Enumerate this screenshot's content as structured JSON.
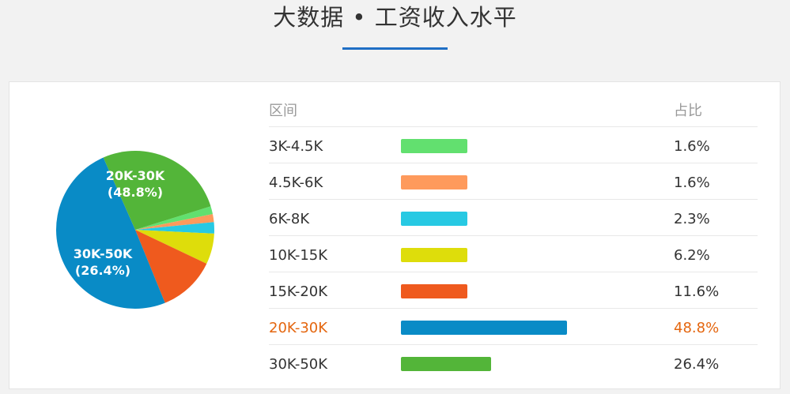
{
  "header": {
    "title": "大数据 • 工资收入水平"
  },
  "table": {
    "col_range": "区间",
    "col_share": "占比"
  },
  "chart_data": {
    "type": "pie",
    "title": "大数据 • 工资收入水平",
    "highlight_index": 5,
    "slices": [
      {
        "label": "3K-4.5K",
        "value": 1.6,
        "display": "1.6%",
        "color": "#62e06f"
      },
      {
        "label": "4.5K-6K",
        "value": 1.6,
        "display": "1.6%",
        "color": "#fe9a5c"
      },
      {
        "label": "6K-8K",
        "value": 2.3,
        "display": "2.3%",
        "color": "#27c9e3"
      },
      {
        "label": "10K-15K",
        "value": 6.2,
        "display": "6.2%",
        "color": "#dedd0b"
      },
      {
        "label": "15K-20K",
        "value": 11.6,
        "display": "11.6%",
        "color": "#ef5a1e"
      },
      {
        "label": "20K-30K",
        "value": 48.8,
        "display": "48.8%",
        "color": "#098bc6"
      },
      {
        "label": "30K-50K",
        "value": 26.4,
        "display": "26.4%",
        "color": "#53b539"
      }
    ],
    "pie_labels": [
      {
        "line1": "20K-30K",
        "line2": "(48.8%)"
      },
      {
        "line1": "30K-50K",
        "line2": "(26.4%)"
      }
    ]
  }
}
